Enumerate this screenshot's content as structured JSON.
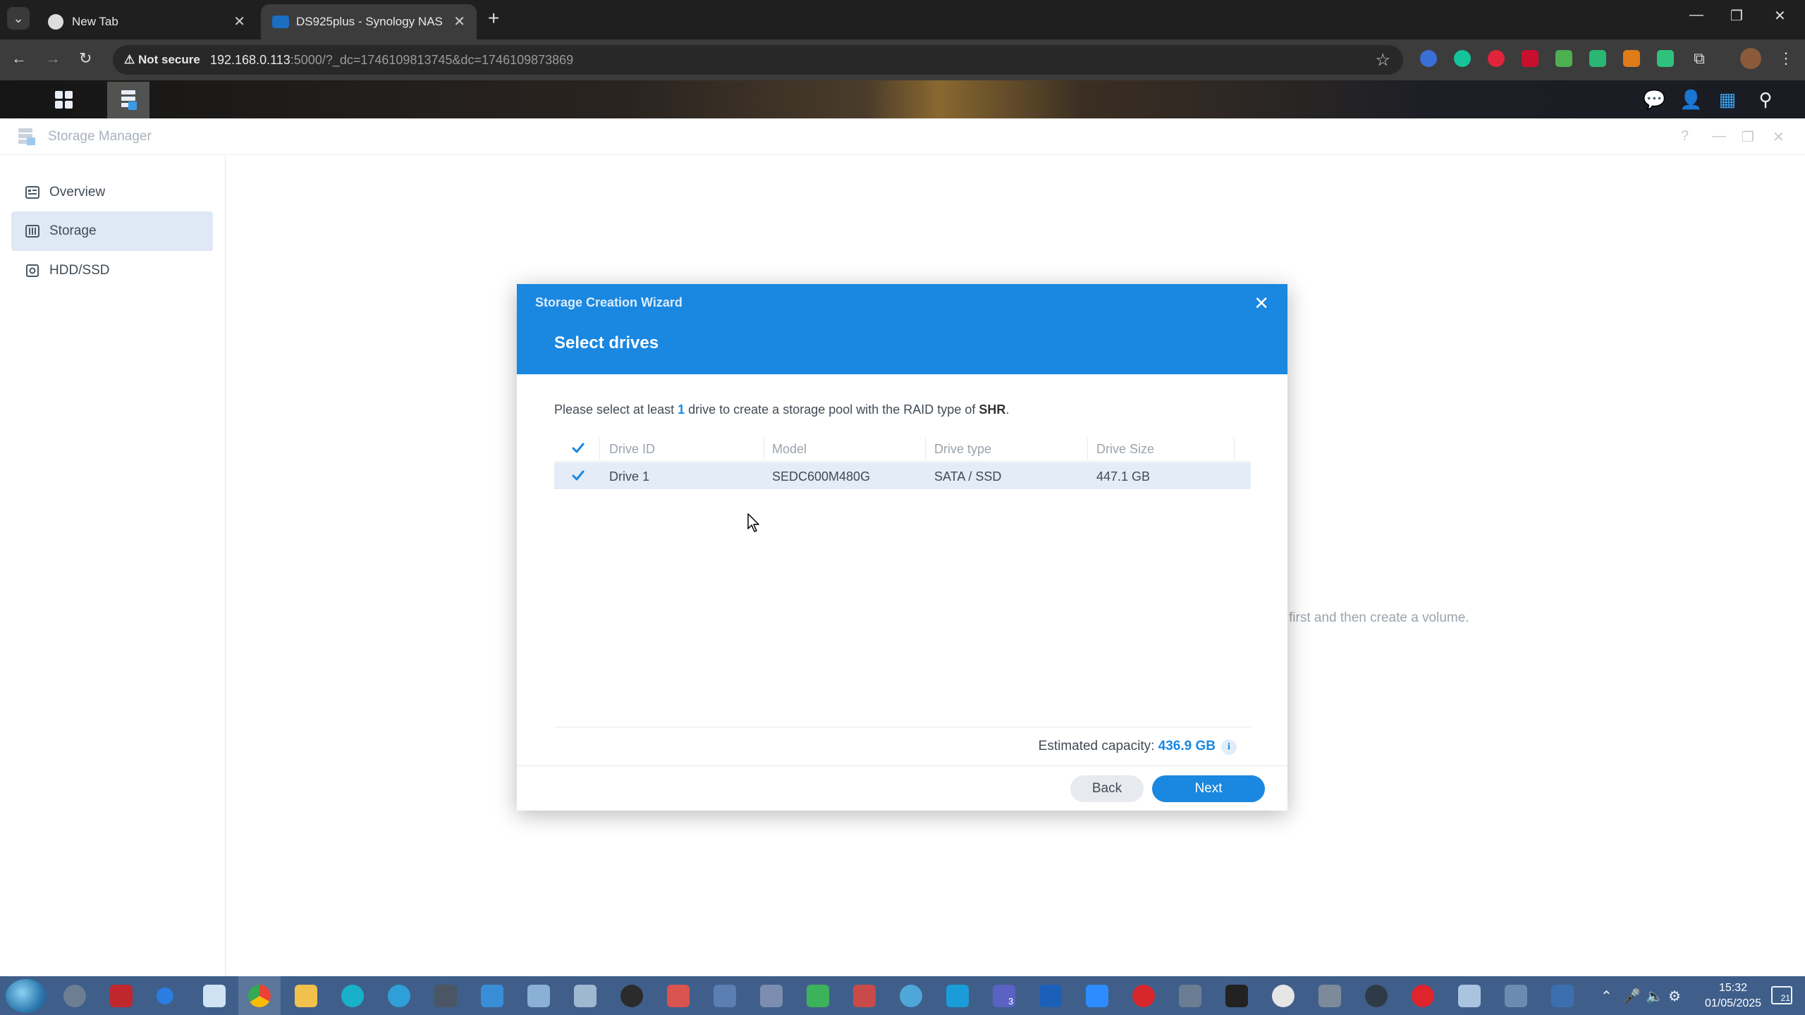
{
  "browser": {
    "tabs": [
      {
        "title": "New Tab",
        "active": false
      },
      {
        "title": "DS925plus - Synology NAS",
        "active": true
      }
    ],
    "security_label": "Not secure",
    "url_host": "192.168.0.113",
    "url_rest": ":5000/?_dc=1746109813745&dc=1746109873869"
  },
  "app": {
    "title": "Storage Manager",
    "sidebar": [
      {
        "label": "Overview",
        "icon": "overview-icon",
        "active": false
      },
      {
        "label": "Storage",
        "icon": "storage-icon",
        "active": true
      },
      {
        "label": "HDD/SSD",
        "icon": "hdd-icon",
        "active": false
      }
    ],
    "background_hint": "first and then create a volume."
  },
  "wizard": {
    "title": "Storage Creation Wizard",
    "step_title": "Select drives",
    "instruction": {
      "prefix": "Please select at least ",
      "count": "1",
      "middle": " drive to create a storage pool with the RAID type of ",
      "raid": "SHR",
      "suffix": "."
    },
    "columns": [
      "Drive ID",
      "Model",
      "Drive type",
      "Drive Size"
    ],
    "rows": [
      {
        "checked": true,
        "drive_id": "Drive 1",
        "model": "SEDC600M480G",
        "drive_type": "SATA / SSD",
        "drive_size": "447.1 GB"
      }
    ],
    "estimated_label": "Estimated capacity: ",
    "estimated_value": "436.9 GB",
    "back_label": "Back",
    "next_label": "Next"
  },
  "taskbar": {
    "time": "15:32",
    "date": "01/05/2025",
    "notification_count": "21",
    "teams_badge": "3"
  },
  "colors": {
    "accent": "#1a87e0",
    "selected_row": "#e3ecf7",
    "taskbar": "#3f5f8a"
  }
}
